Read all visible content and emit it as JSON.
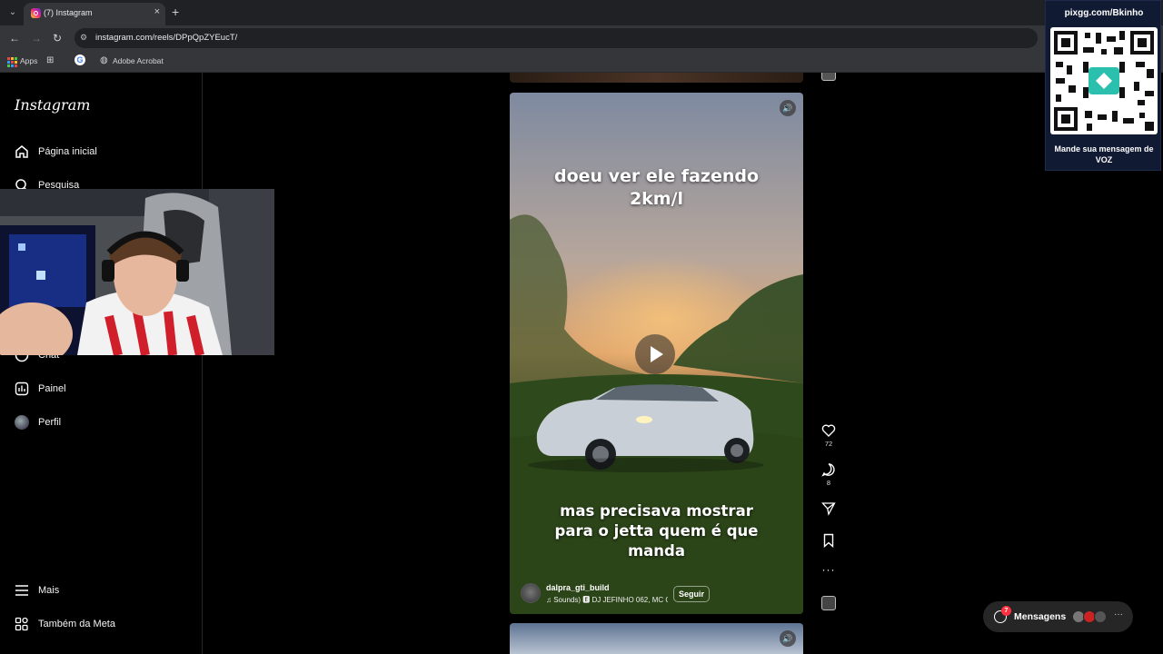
{
  "browser": {
    "tab_title": "(7) Instagram",
    "tab_close": "×",
    "new_tab": "+",
    "url": "instagram.com/reels/DPpQpZYEucT/",
    "bookmarks": [
      {
        "label": "Apps"
      },
      {
        "label": "Adobe Acrobat"
      }
    ]
  },
  "sidebar": {
    "logo": "Instagram",
    "items": [
      {
        "label": "Página inicial",
        "icon": "home-icon"
      },
      {
        "label": "Pesquisa",
        "icon": "search-icon"
      },
      {
        "label": "Chat",
        "icon": "messenger-icon"
      },
      {
        "label": "Painel",
        "icon": "dashboard-icon"
      },
      {
        "label": "Perfil",
        "icon": "avatar"
      }
    ],
    "bottom": [
      {
        "label": "Mais",
        "icon": "menu-icon"
      },
      {
        "label": "Também da Meta",
        "icon": "meta-icon"
      }
    ]
  },
  "reel": {
    "caption_top": "doeu ver ele fazendo 2km/l",
    "caption_bottom": "mas precisava mostrar para o jetta quem é que manda",
    "author": "dalpra_gti_build",
    "audio": "♫ Sounds) 🅴 DJ JEFINHO 062, MC C",
    "follow": "Seguir",
    "likes": "72",
    "comments": "8"
  },
  "overlay": {
    "qr_title": "pixgg.com/Bkinho",
    "qr_caption": "Mande sua mensagem de VOZ"
  },
  "messages": {
    "label": "Mensagens",
    "badge": "7",
    "more": "···"
  },
  "colors": {
    "accent_badge": "#ff3040",
    "browser_dark": "#202124",
    "browser_mid": "#35363a",
    "qr_card": "#101a33"
  }
}
